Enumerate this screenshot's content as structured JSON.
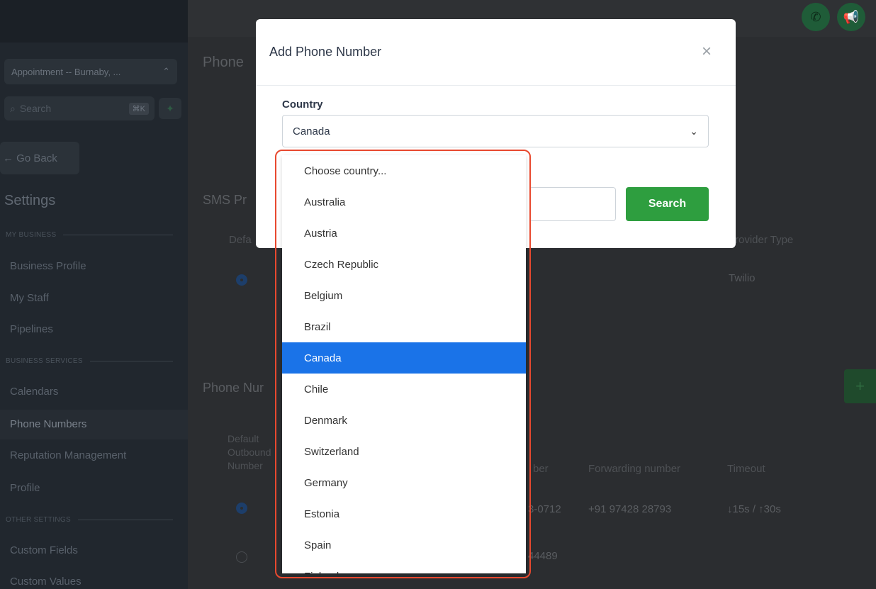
{
  "sidebar": {
    "location": "Appointment -- Burnaby, ...",
    "search_placeholder": "Search",
    "search_shortcut": "⌘K",
    "go_back": "← Go Back",
    "settings_title": "Settings",
    "sections": {
      "my_business": "MY BUSINESS",
      "business_services": "BUSINESS SERVICES",
      "other_settings": "OTHER SETTINGS"
    },
    "items": {
      "business_profile": "Business Profile",
      "my_staff": "My Staff",
      "pipelines": "Pipelines",
      "calendars": "Calendars",
      "phone_numbers": "Phone Numbers",
      "reputation_management": "Reputation Management",
      "profile": "Profile",
      "custom_fields": "Custom Fields",
      "custom_values": "Custom Values"
    }
  },
  "main": {
    "phone_heading": "Phone",
    "sms_heading": "SMS Pr",
    "sms_col_default": "Defa",
    "sms_col_provider_type": "rovider Type",
    "sms_provider_value": "Twilio",
    "numbers_heading": "Phone Nur",
    "col_default_1": "Default",
    "col_default_2": "Outbound",
    "col_default_3": "Number",
    "col_number": "ber",
    "col_forwarding": "Forwarding number",
    "col_timeout": "Timeout",
    "row1_number": "3-0712",
    "row1_forwarding": "+91 97428 28793",
    "row1_timeout": "↓15s / ↑30s",
    "row2_number": "44489"
  },
  "modal": {
    "title": "Add Phone Number",
    "close": "×",
    "country_label": "Country",
    "country_value": "Canada",
    "search_button": "Search"
  },
  "dropdown": {
    "options": [
      "Choose country...",
      "Australia",
      "Austria",
      "Czech Republic",
      "Belgium",
      "Brazil",
      "Canada",
      "Chile",
      "Denmark",
      "Switzerland",
      "Germany",
      "Estonia",
      "Spain",
      "Finland"
    ],
    "selected": "Canada"
  },
  "colors": {
    "primary_green": "#2e9e3f",
    "selected_blue": "#1a73e8",
    "highlight_red": "#e8492f"
  }
}
